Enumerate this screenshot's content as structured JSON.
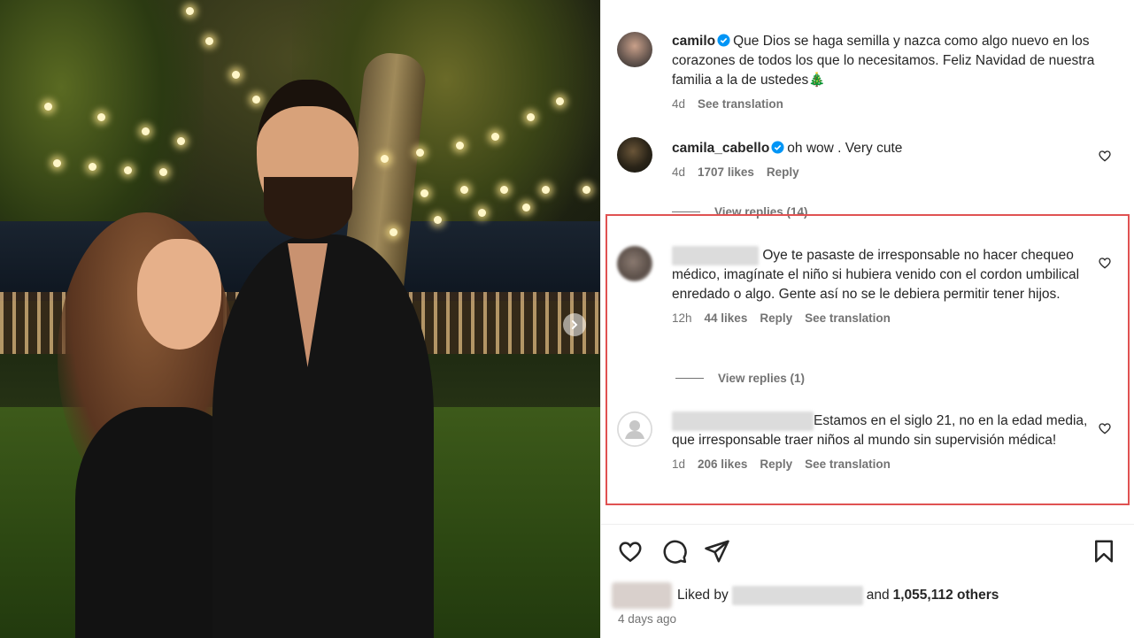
{
  "caption": {
    "username": "camilo",
    "text": "Que Dios se haga semilla y nazca como algo nuevo en los corazones de todos los que lo necesitamos. Feliz Navidad de nuestra familia a la de ustedes🎄",
    "time": "4d",
    "see_translation": "See translation"
  },
  "comments": [
    {
      "username": "camila_cabello",
      "text": "oh wow . Very cute",
      "time": "4d",
      "likes": "1707 likes",
      "reply": "Reply",
      "view_replies": "View replies (14)"
    },
    {
      "username": "",
      "text": "Oye te pasaste de irresponsable no hacer chequeo médico, imagínate el niño si hubiera venido con el cordon umbilical enredado o algo. Gente así no se le debiera permitir tener hijos.",
      "time": "12h",
      "likes": "44 likes",
      "reply": "Reply",
      "see_translation": "See translation",
      "view_replies": "View replies (1)"
    },
    {
      "username": "",
      "text": "Estamos en el siglo 21, no en la edad media, que irresponsable traer niños al mundo sin supervisión médica!",
      "time": "1d",
      "likes": "206 likes",
      "reply": "Reply",
      "see_translation": "See translation"
    }
  ],
  "likes": {
    "prefix": "Liked by",
    "and": "and",
    "others": "1,055,112 others"
  },
  "posted": "4 days ago",
  "colors": {
    "highlight_border": "#e05252",
    "verified": "#0095f6",
    "muted_text": "#737373"
  },
  "icons": [
    "heart-icon",
    "comment-icon",
    "share-icon",
    "bookmark-icon",
    "verified-icon",
    "chevron-right-icon",
    "default-avatar-icon"
  ]
}
